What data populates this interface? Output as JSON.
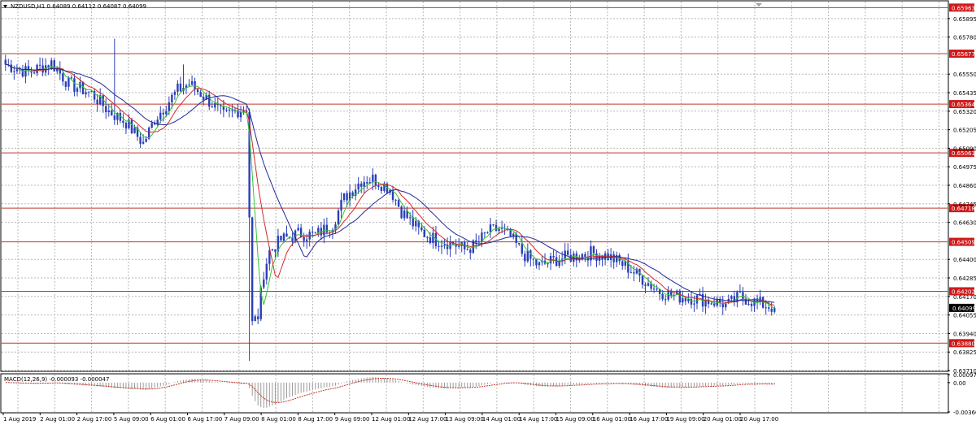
{
  "colors": {
    "background": "#ffffff",
    "grid": "#b8b8b8",
    "candle": "#2a3fb8",
    "hline": "#c0392b",
    "hline_label_bg": "#d01a1a",
    "price_label_bg": "#000000",
    "ma_fast": "#34c534",
    "ma_mid": "#d22a2a",
    "ma_slow": "#1f2a9a",
    "macd_hist": "#9a9a9a",
    "macd_signal": "#c0392b"
  },
  "header": {
    "symbol_info": "NZDUSD,H1  0.64089 0.64112 0.64087 0.64099"
  },
  "price_tag": "0.64099",
  "macd_label": "MACD(12,26,9) -0.000093 -0.000047",
  "chart_data": [
    {
      "type": "candlestick",
      "title": "NZDUSD,H1",
      "ylim": [
        0.6371,
        0.66
      ],
      "x_ticks": [
        "1 Aug 2019",
        "2 Aug 01:00",
        "2 Aug 17:00",
        "5 Aug 09:00",
        "6 Aug 01:00",
        "6 Aug 17:00",
        "7 Aug 09:00",
        "8 Aug 01:00",
        "8 Aug 17:00",
        "9 Aug 09:00",
        "12 Aug 01:00",
        "12 Aug 17:00",
        "13 Aug 09:00",
        "14 Aug 01:00",
        "14 Aug 17:00",
        "15 Aug 09:00",
        "16 Aug 01:00",
        "16 Aug 17:00",
        "19 Aug 09:00",
        "20 Aug 01:00",
        "20 Aug 17:00"
      ],
      "y_ticks": [
        "0.65895",
        "0.65780",
        "0.65550",
        "0.65435",
        "0.65320",
        "0.65205",
        "0.65090",
        "0.64975",
        "0.64860",
        "0.64745",
        "0.64630",
        "0.64400",
        "0.64285",
        "0.64170",
        "0.64055",
        "0.63940",
        "0.63825",
        "0.63710"
      ],
      "y_tick_values": [
        0.65895,
        0.6578,
        0.6555,
        0.65435,
        0.6532,
        0.65205,
        0.6509,
        0.64975,
        0.6486,
        0.64745,
        0.6463,
        0.644,
        0.64285,
        0.6417,
        0.64055,
        0.6394,
        0.63825,
        0.6371
      ],
      "horizontal_levels": [
        "0.65963",
        "0.65677",
        "0.65364",
        "0.65061",
        "0.64718",
        "0.64509",
        "0.64202",
        "0.63880"
      ],
      "horizontal_level_values": [
        0.65963,
        0.65677,
        0.65364,
        0.65061,
        0.64718,
        0.64509,
        0.64202,
        0.6388
      ],
      "last_price": 0.64099,
      "price_anchors": [
        [
          0,
          0.6561
        ],
        [
          8,
          0.6556
        ],
        [
          16,
          0.6562
        ],
        [
          22,
          0.6549
        ],
        [
          30,
          0.6543
        ],
        [
          36,
          0.6532
        ],
        [
          42,
          0.6525
        ],
        [
          48,
          0.6512
        ],
        [
          52,
          0.6527
        ],
        [
          56,
          0.6536
        ],
        [
          60,
          0.6545
        ],
        [
          64,
          0.6549
        ],
        [
          70,
          0.654
        ],
        [
          76,
          0.6529
        ],
        [
          80,
          0.6532
        ],
        [
          84,
          0.6534
        ],
        [
          86,
          0.64
        ],
        [
          88,
          0.6405
        ],
        [
          90,
          0.6432
        ],
        [
          92,
          0.6445
        ],
        [
          96,
          0.6452
        ],
        [
          102,
          0.6456
        ],
        [
          108,
          0.6455
        ],
        [
          114,
          0.6462
        ],
        [
          118,
          0.6478
        ],
        [
          124,
          0.6489
        ],
        [
          128,
          0.649
        ],
        [
          134,
          0.6484
        ],
        [
          138,
          0.647
        ],
        [
          144,
          0.6458
        ],
        [
          150,
          0.6452
        ],
        [
          156,
          0.645
        ],
        [
          160,
          0.6446
        ],
        [
          164,
          0.6449
        ],
        [
          168,
          0.6457
        ],
        [
          172,
          0.6459
        ],
        [
          176,
          0.6454
        ],
        [
          180,
          0.6444
        ],
        [
          186,
          0.6436
        ],
        [
          192,
          0.644
        ],
        [
          198,
          0.6442
        ],
        [
          204,
          0.6444
        ],
        [
          210,
          0.6442
        ],
        [
          216,
          0.6436
        ],
        [
          222,
          0.6428
        ],
        [
          228,
          0.642
        ],
        [
          234,
          0.6417
        ],
        [
          240,
          0.6416
        ],
        [
          246,
          0.6414
        ],
        [
          252,
          0.6412
        ],
        [
          256,
          0.6417
        ],
        [
          262,
          0.6413
        ],
        [
          268,
          0.641
        ]
      ]
    },
    {
      "type": "line",
      "title": "MACD(12,26,9) -0.000093 -0.000047",
      "ylim": [
        -0.003603,
        0.000978
      ],
      "y_ticks": [
        "0.000978",
        "0.00",
        "-0.003603"
      ],
      "y_tick_values": [
        0.000978,
        0.0,
        -0.003603
      ]
    }
  ]
}
